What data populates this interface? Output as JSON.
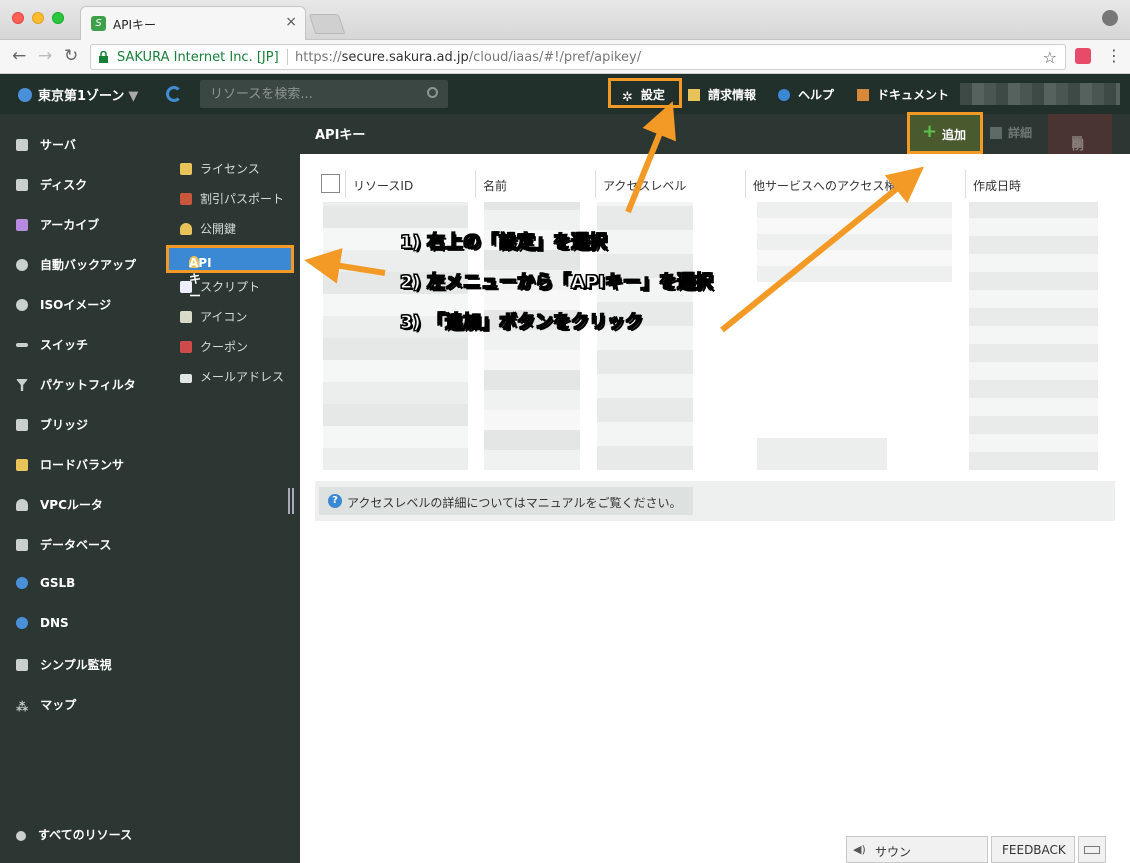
{
  "browser": {
    "tab_title": "APIキー",
    "secure_label": "SAKURA Internet Inc. [JP]",
    "url_scheme": "https://",
    "url_host": "secure.sakura.ad.jp",
    "url_path": "/cloud/iaas/#!/pref/apikey/"
  },
  "header": {
    "zone": "東京第1ゾーン",
    "search_placeholder": "リソースを検索...",
    "settings": "設定",
    "billing": "請求情報",
    "help": "ヘルプ",
    "docs": "ドキュメント"
  },
  "leftnav": [
    {
      "label": "サーバ",
      "icon": "server-icon"
    },
    {
      "label": "ディスク",
      "icon": "disk-icon"
    },
    {
      "label": "アーカイブ",
      "icon": "archive-icon"
    },
    {
      "label": "自動バックアップ",
      "icon": "backup-icon"
    },
    {
      "label": "ISOイメージ",
      "icon": "iso-icon"
    },
    {
      "label": "スイッチ",
      "icon": "switch-icon"
    },
    {
      "label": "パケットフィルタ",
      "icon": "filter-icon"
    },
    {
      "label": "ブリッジ",
      "icon": "bridge-icon"
    },
    {
      "label": "ロードバランサ",
      "icon": "loadbalancer-icon"
    },
    {
      "label": "VPCルータ",
      "icon": "vpc-router-icon"
    },
    {
      "label": "データベース",
      "icon": "database-icon"
    },
    {
      "label": "GSLB",
      "icon": "gslb-icon"
    },
    {
      "label": "DNS",
      "icon": "dns-icon"
    },
    {
      "label": "シンプル監視",
      "icon": "monitor-icon"
    },
    {
      "label": "マップ",
      "icon": "map-icon"
    }
  ],
  "all_resources": "すべてのリソース",
  "subnav": {
    "items": [
      "ライセンス",
      "割引パスポート",
      "公開鍵",
      "APIキー",
      "スクリプト",
      "アイコン",
      "クーポン",
      "メールアドレス"
    ],
    "active_index": 3
  },
  "page": {
    "title": "APIキー",
    "add": "追加",
    "detail": "詳細",
    "delete": "削除",
    "columns": [
      "リソースID",
      "名前",
      "アクセスレベル",
      "他サービスへのアクセス権",
      "作成日時"
    ],
    "note": "アクセスレベルの詳細についてはマニュアルをご覧ください。"
  },
  "annotations": {
    "step1": "1) 右上の「設定」を選択",
    "step2": "2) 左メニューから「APIキー」を選択",
    "step3": "3) 「追加」ボタンをクリック"
  },
  "footer": {
    "sound": "サウンド:On+Image",
    "feedback": "FEEDBACK"
  },
  "colors": {
    "header_bg": "#22302c",
    "nav_bg": "#2c3633",
    "active_blue": "#3b88d4",
    "annotation_orange": "#f39a26",
    "add_green": "#5ec24a"
  }
}
